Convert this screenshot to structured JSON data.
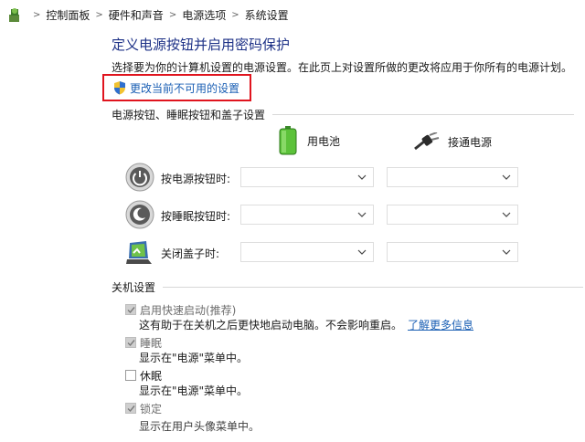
{
  "breadcrumb": [
    "控制面板",
    "硬件和声音",
    "电源选项",
    "系统设置"
  ],
  "title": "定义电源按钮并启用密码保护",
  "subtitle": "选择要为你的计算机设置的电源设置。在此页上对设置所做的更改将应用于你所有的电源计划。",
  "change_link": "更改当前不可用的设置",
  "section_buttons": "电源按钮、睡眠按钮和盖子设置",
  "col_battery": "用电池",
  "col_plugged": "接通电源",
  "rows": [
    {
      "label": "按电源按钮时:",
      "battery": "",
      "plugged": ""
    },
    {
      "label": "按睡眠按钮时:",
      "battery": "",
      "plugged": ""
    },
    {
      "label": "关闭盖子时:",
      "battery": "",
      "plugged": ""
    }
  ],
  "section_shutdown": "关机设置",
  "options": [
    {
      "label": "启用快速启动(推荐)",
      "checked": true,
      "desc": "这有助于在关机之后更快地启动电脑。不会影响重启。",
      "link": "了解更多信息"
    },
    {
      "label": "睡眠",
      "checked": true,
      "desc": "显示在\"电源\"菜单中。"
    },
    {
      "label": "休眠",
      "checked": false,
      "desc": "显示在\"电源\"菜单中。"
    },
    {
      "label": "锁定",
      "checked": true,
      "desc": ""
    }
  ],
  "faded_text": "显示在用户头像菜单中。",
  "colors": {
    "title": "#1e3287",
    "link": "#1a5fb4",
    "highlight": "#e0141e"
  }
}
